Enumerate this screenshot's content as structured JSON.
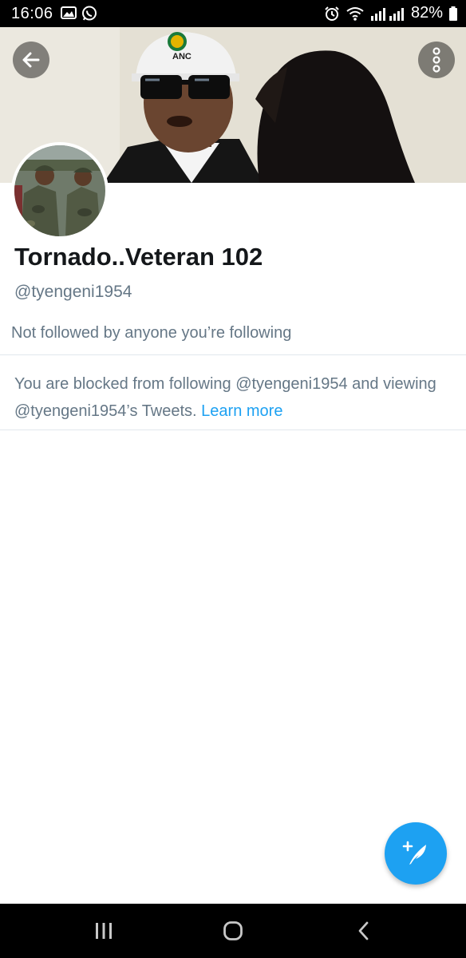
{
  "status_bar": {
    "time": "16:06",
    "battery": "82%",
    "icons": [
      "gallery-icon",
      "whatsapp-icon",
      "alarm-icon",
      "wifi-icon",
      "signal-icon",
      "battery-icon"
    ]
  },
  "header": {
    "back_icon": "arrow-left-icon",
    "more_icon": "more-vertical-icon",
    "cap_text": "ANC"
  },
  "profile": {
    "name": "Tornado..Veteran 102",
    "handle": "@tyengeni1954",
    "followed_by": "Not followed by anyone you’re following"
  },
  "blocked": {
    "message": "You are blocked from following @tyengeni1954 and viewing @tyengeni1954’s Tweets.",
    "link": "Learn more"
  },
  "fab": {
    "icon": "compose-tweet-icon"
  },
  "nav": {
    "icons": [
      "recent-apps-icon",
      "home-icon",
      "back-icon"
    ]
  },
  "colors": {
    "accent": "#1da1f2",
    "secondary_text": "#657786",
    "primary_text": "#14171a",
    "divider": "#e1e8ed"
  }
}
